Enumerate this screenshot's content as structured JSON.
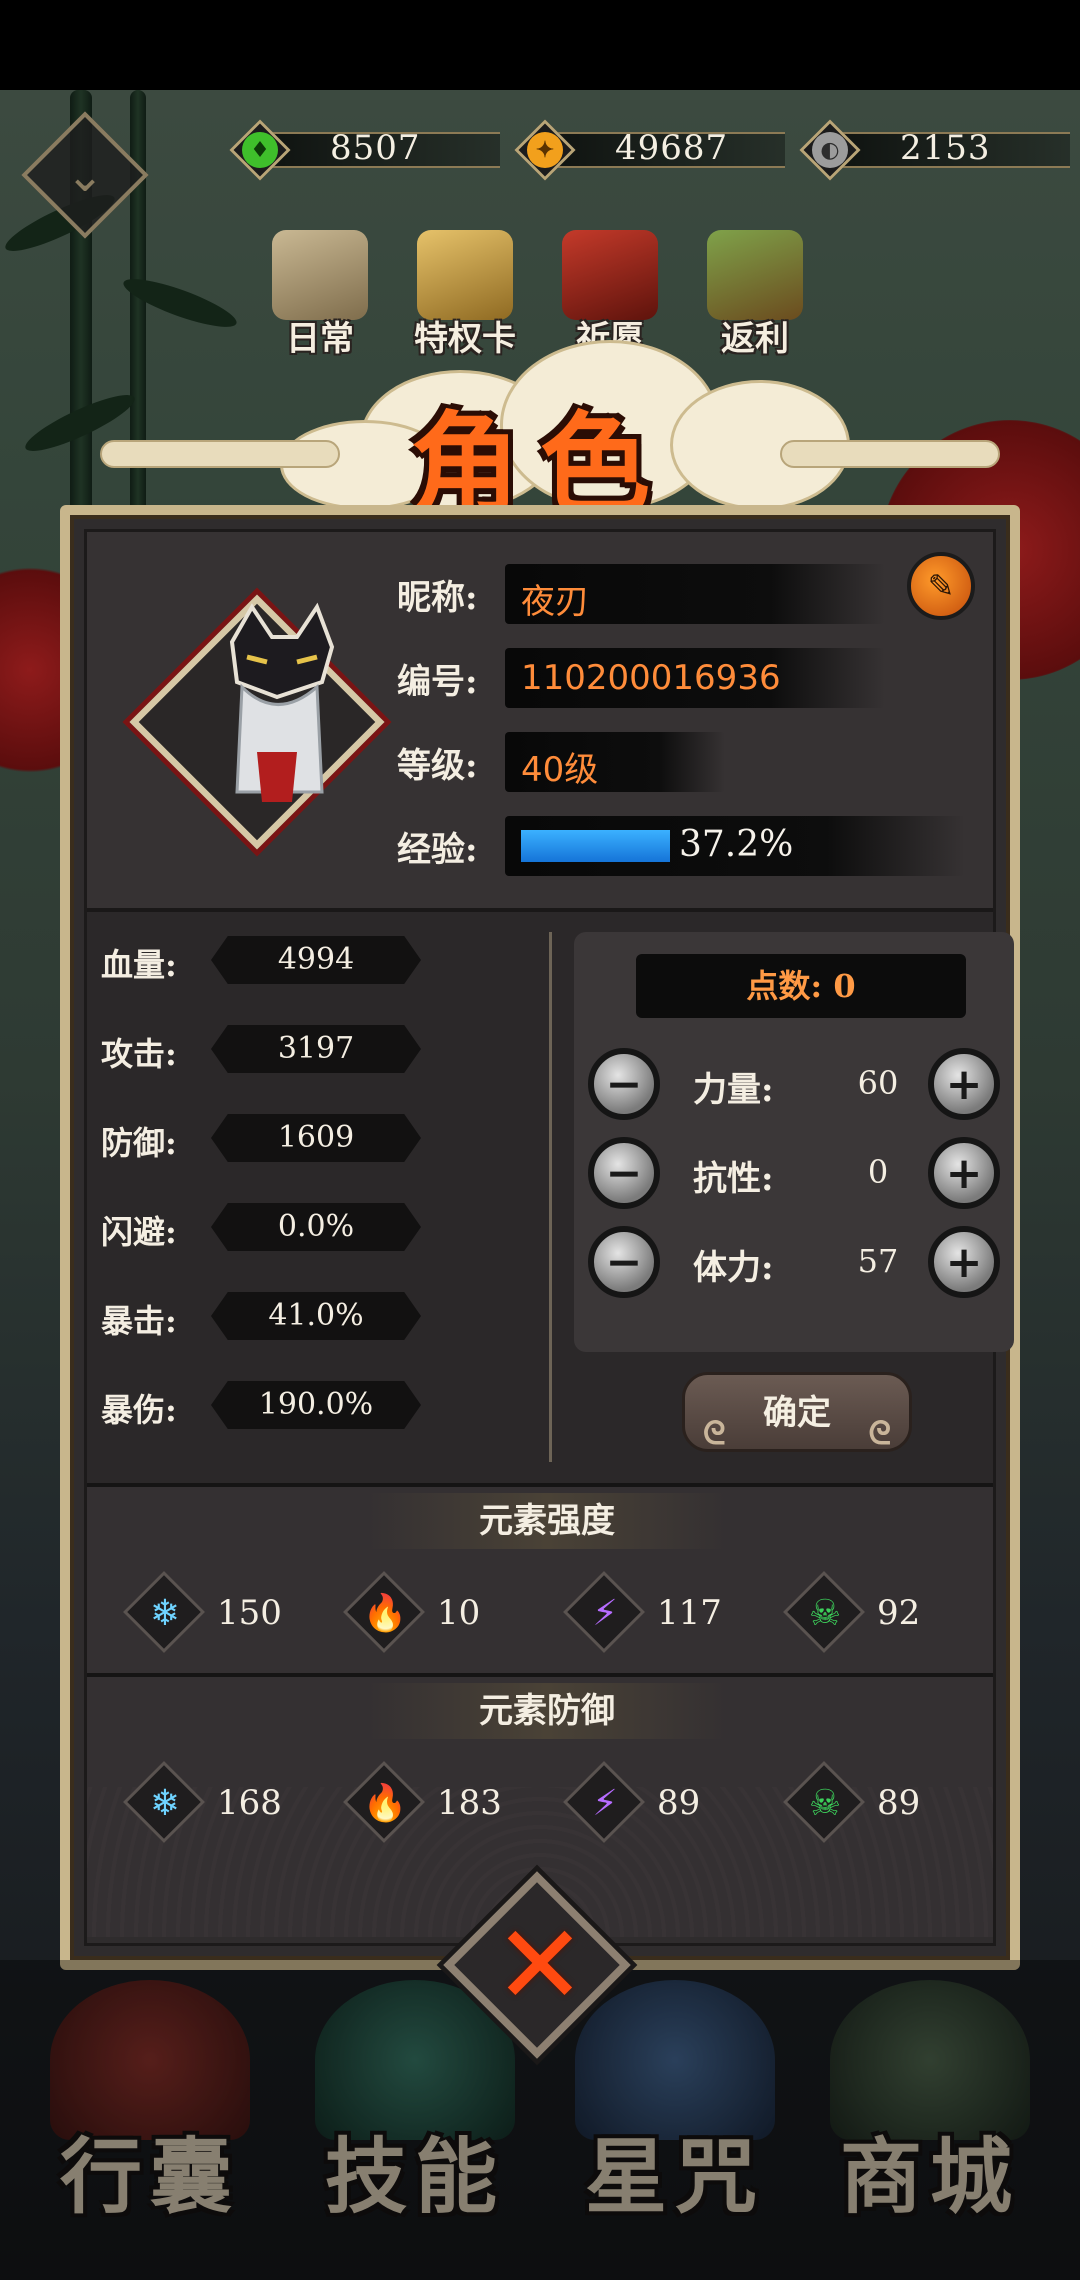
{
  "currencies": [
    {
      "icon": "green-jade-icon",
      "amount": "8507",
      "color": "#3fbf2b"
    },
    {
      "icon": "gold-coin-icon",
      "amount": "49687",
      "color": "#f2a01c"
    },
    {
      "icon": "silver-orb-icon",
      "amount": "2153",
      "color": "#9c9c9c"
    }
  ],
  "top_menu": [
    {
      "label": "日常",
      "icon": "scroll-icon"
    },
    {
      "label": "特权卡",
      "icon": "privilege-card-icon"
    },
    {
      "label": "祈愿",
      "icon": "torii-gate-icon"
    },
    {
      "label": "返利",
      "icon": "treasure-chest-icon"
    }
  ],
  "title": "角色",
  "profile": {
    "nickname_label": "昵称:",
    "nickname": "夜刃",
    "id_label": "编号:",
    "id": "110200016936",
    "level_label": "等级:",
    "level": "40级",
    "exp_label": "经验:",
    "exp_text": "37.2%",
    "exp_fraction": 0.372
  },
  "stats": [
    {
      "label": "血量:",
      "value": "4994"
    },
    {
      "label": "攻击:",
      "value": "3197"
    },
    {
      "label": "防御:",
      "value": "1609"
    },
    {
      "label": "闪避:",
      "value": "0.0%"
    },
    {
      "label": "暴击:",
      "value": "41.0%"
    },
    {
      "label": "暴伤:",
      "value": "190.0%"
    }
  ],
  "points": {
    "header": "点数: 0",
    "attributes": [
      {
        "label": "力量:",
        "value": "60"
      },
      {
        "label": "抗性:",
        "value": "0"
      },
      {
        "label": "体力:",
        "value": "57"
      }
    ],
    "minus": "−",
    "plus": "+",
    "confirm_label": "确定"
  },
  "element_strength": {
    "title": "元素强度",
    "items": [
      {
        "icon": "ice-icon",
        "glyph": "❄",
        "value": "150",
        "color": "#6fd3ff"
      },
      {
        "icon": "fire-icon",
        "glyph": "🔥",
        "value": "10",
        "color": "#ff8a1e"
      },
      {
        "icon": "lightning-icon",
        "glyph": "⚡",
        "value": "117",
        "color": "#b66cff"
      },
      {
        "icon": "poison-skull-icon",
        "glyph": "☠",
        "value": "92",
        "color": "#3ccf5a"
      }
    ]
  },
  "element_defense": {
    "title": "元素防御",
    "items": [
      {
        "icon": "ice-icon",
        "glyph": "❄",
        "value": "168",
        "color": "#6fd3ff"
      },
      {
        "icon": "fire-icon",
        "glyph": "🔥",
        "value": "183",
        "color": "#ff8a1e"
      },
      {
        "icon": "lightning-icon",
        "glyph": "⚡",
        "value": "89",
        "color": "#b66cff"
      },
      {
        "icon": "poison-skull-icon",
        "glyph": "☠",
        "value": "89",
        "color": "#3ccf5a"
      }
    ]
  },
  "close_label": "✕",
  "bottom_nav": [
    {
      "label": "行囊",
      "icon": "bag-icon"
    },
    {
      "label": "技能",
      "icon": "skill-icon"
    },
    {
      "label": "星咒",
      "icon": "star-map-icon"
    },
    {
      "label": "商城",
      "icon": "shop-icon"
    }
  ]
}
